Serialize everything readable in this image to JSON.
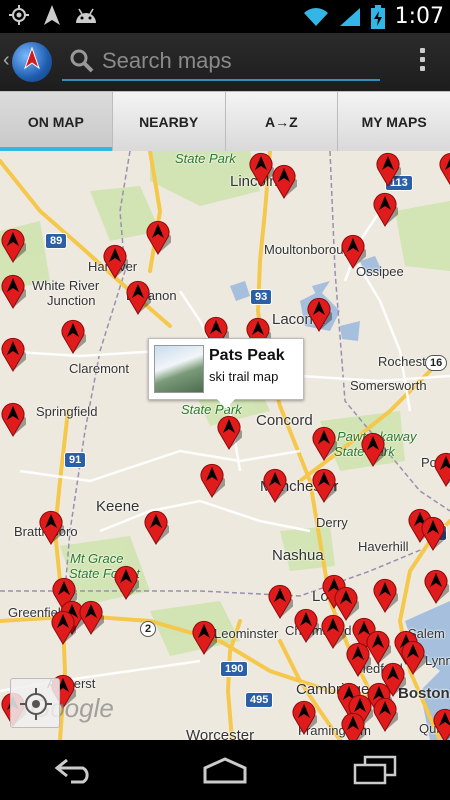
{
  "status_bar": {
    "time": "1:07",
    "left_icons": [
      "location-target-icon",
      "gps-arrow-icon",
      "android-icon"
    ],
    "right_icons": [
      "wifi-icon",
      "signal-icon",
      "battery-charging-icon"
    ]
  },
  "action_bar": {
    "search_placeholder": "Search maps",
    "app_icon": "globe-icon",
    "menu_icon": "overflow-menu-icon"
  },
  "tabs": [
    {
      "label": "ON MAP",
      "active": true
    },
    {
      "label": "NEARBY",
      "active": false
    },
    {
      "label": "A→Z",
      "active": false
    },
    {
      "label": "MY MAPS",
      "active": false
    }
  ],
  "map": {
    "info_bubble": {
      "title": "Pats Peak",
      "subtitle": "ski trail map"
    },
    "places": {
      "state_park_top": "State Park",
      "lincoln": "Lincoln",
      "moultonborough": "Moultonborough",
      "ossipee": "Ossipee",
      "hanover": "Hanover",
      "white_river": "White River",
      "junction": "Junction",
      "lebanon": "Lebanon",
      "laconia": "Laconia",
      "claremont": "Claremont",
      "rochester": "Rochester",
      "somersworth": "Somersworth",
      "springfield": "Springfield",
      "state_park_mid": "State Park",
      "concord": "Concord",
      "pawtuckaway": "Pawtuckaway",
      "state_park_right": "State Park",
      "ports": "Ports",
      "keene": "Keene",
      "manchester": "Manchester",
      "brattleboro": "Brattleboro",
      "derry": "Derry",
      "haverhill": "Haverhill",
      "mt_grace": "Mt Grace",
      "state_forest": "State Forest",
      "nashua": "Nashua",
      "greenfield": "Greenfield",
      "lowell": "Lowell",
      "salem": "Salem",
      "leominster": "Leominster",
      "chelmsford": "Chelmsford",
      "lynn": "Lynn",
      "amherst": "Amherst",
      "medford": "Medford",
      "cambridge": "Cambridge",
      "boston": "Boston",
      "worcester": "Worcester",
      "framingham": "Framingham",
      "quincy": "Quinc"
    },
    "shields": {
      "r113": "113",
      "r89": "89",
      "r93": "93",
      "r16": "16",
      "r91": "91",
      "r95": "95",
      "r2": "2",
      "r190": "190",
      "r495": "495"
    },
    "google_logo": "Google"
  },
  "nav_bar": {
    "icons": [
      "back-icon",
      "home-icon",
      "recent-apps-icon"
    ]
  },
  "colors": {
    "accent": "#33b5e5",
    "pin_red": "#e01b1b",
    "map_bg": "#eee9df",
    "water": "#a5bfdd",
    "park": "#c8dfa8",
    "highway": "#f5c84b"
  }
}
